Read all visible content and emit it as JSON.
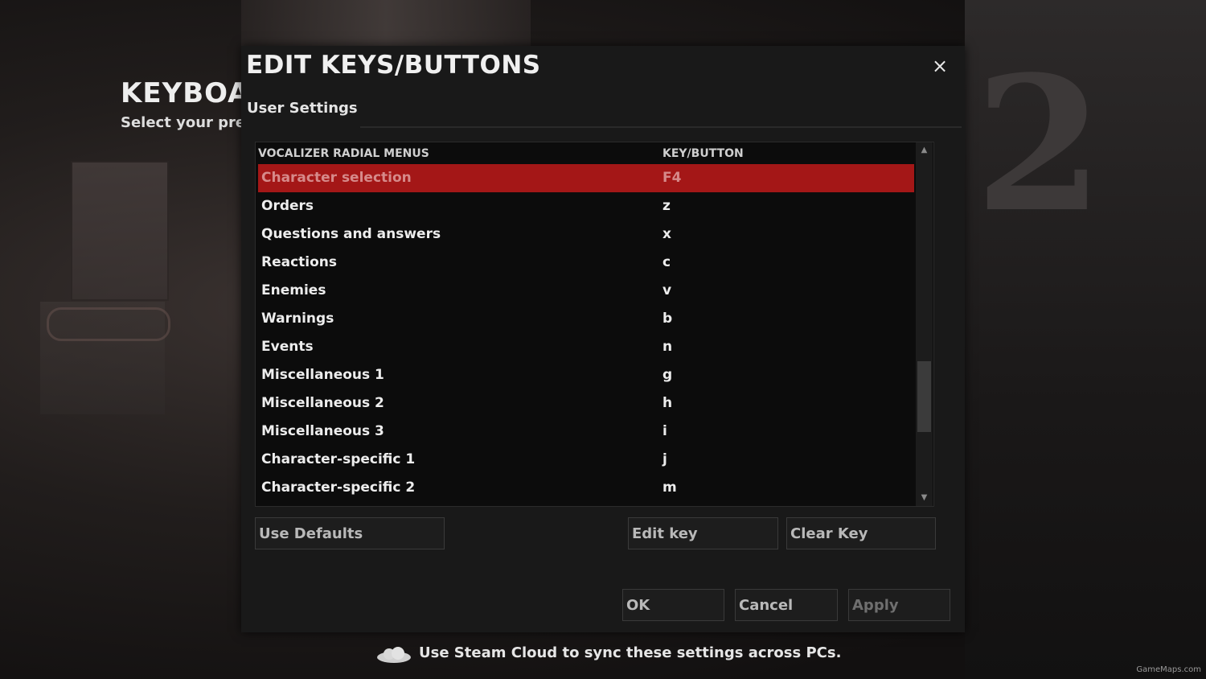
{
  "background": {
    "page_title": "KEYBOA",
    "page_subtitle": "Select your pre"
  },
  "dialog": {
    "title": "EDIT KEYS/BUTTONS",
    "close_label": "×",
    "tab_label": "User Settings",
    "list": {
      "section_header": "VOCALIZER RADIAL MENUS",
      "key_header": "KEY/BUTTON",
      "rows": [
        {
          "action": "Character selection",
          "key": "F4",
          "selected": true
        },
        {
          "action": "Orders",
          "key": "z"
        },
        {
          "action": "Questions and answers",
          "key": "x"
        },
        {
          "action": "Reactions",
          "key": "c"
        },
        {
          "action": "Enemies",
          "key": "v"
        },
        {
          "action": "Warnings",
          "key": "b"
        },
        {
          "action": "Events",
          "key": "n"
        },
        {
          "action": "Miscellaneous 1",
          "key": "g"
        },
        {
          "action": "Miscellaneous 2",
          "key": "h"
        },
        {
          "action": "Miscellaneous 3",
          "key": "i"
        },
        {
          "action": "Character-specific 1",
          "key": "j"
        },
        {
          "action": "Character-specific 2",
          "key": "m"
        }
      ]
    },
    "buttons": {
      "use_defaults": "Use Defaults",
      "edit_key": "Edit key",
      "clear_key": "Clear Key",
      "ok": "OK",
      "cancel": "Cancel",
      "apply": "Apply"
    }
  },
  "footer": {
    "cloud_text": "Use Steam Cloud to sync these settings across PCs.",
    "icon": "cloud-icon"
  },
  "watermark": "GameMaps.com",
  "colors": {
    "selected_row": "#a41717",
    "dialog_bg": "#191919",
    "list_bg": "#0c0c0c"
  }
}
